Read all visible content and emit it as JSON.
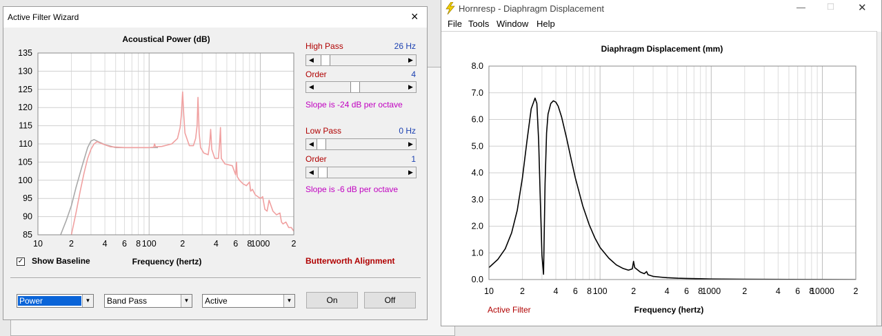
{
  "wizard": {
    "title": "Active Filter Wizard",
    "plot_title": "Acoustical Power (dB)",
    "xlabel": "Frequency (hertz)",
    "show_baseline_label": "Show Baseline",
    "show_baseline_checked": "✓",
    "high_pass": {
      "label": "High Pass",
      "value": "26 Hz",
      "order_label": "Order",
      "order_value": "4",
      "slope": "Slope is -24 dB per octave",
      "position": 0.05,
      "order_position": 0.43
    },
    "low_pass": {
      "label": "Low Pass",
      "value": "0 Hz",
      "order_label": "Order",
      "order_value": "1",
      "slope": "Slope is -6 dB per octave",
      "position": 0.0,
      "order_position": 0.02
    },
    "alignment": "Butterworth Alignment",
    "combo_type": "Power",
    "combo_filter": "Band Pass",
    "combo_mode": "Active",
    "on_button": "On",
    "off_button": "Off",
    "close_icon": "×",
    "colors": {
      "baseline": "#a8a8a8",
      "filtered": "#f0a0a0",
      "label_red": "#b00000",
      "value_blue": "#1a3fb0",
      "slope_magenta": "#c000c0"
    }
  },
  "hornresp": {
    "title": "Hornresp - Diaphragm Displacement",
    "menu": [
      "File",
      "Tools",
      "Window",
      "Help"
    ],
    "plot_title": "Diaphragm Displacement (mm)",
    "xlabel": "Frequency (hertz)",
    "footer_label": "Active Filter",
    "minimize_icon": "—",
    "maximize_icon": "□",
    "close_icon": "✕",
    "app_icon": "lightning-icon"
  },
  "chart_data": [
    {
      "type": "line",
      "title": "Acoustical Power (dB)",
      "xlabel": "Frequency (hertz)",
      "ylabel": "",
      "x_scale": "log",
      "xlim": [
        10,
        2000
      ],
      "ylim": [
        85,
        135
      ],
      "x_tick_labels": [
        "10",
        "2",
        "4",
        "6",
        "8",
        "100",
        "2",
        "4",
        "6",
        "8",
        "1000",
        "2"
      ],
      "y_tick_labels": [
        "85",
        "90",
        "95",
        "100",
        "105",
        "110",
        "115",
        "120",
        "125",
        "130",
        "135"
      ],
      "grid": true,
      "series": [
        {
          "style": "baseline",
          "x": [
            16,
            18,
            20,
            22,
            25,
            28,
            30,
            32,
            35,
            40,
            50,
            60,
            80,
            100,
            120
          ],
          "y": [
            85,
            89,
            93,
            98,
            104,
            109,
            110.8,
            111.2,
            110.6,
            109.8,
            109,
            109,
            109,
            109,
            109
          ]
        },
        {
          "style": "filtered",
          "x": [
            20,
            22,
            24,
            26,
            28,
            30,
            32,
            34,
            38,
            45,
            60,
            80,
            100,
            110,
            112,
            114,
            130,
            160,
            180,
            190,
            195,
            200,
            205,
            210,
            230,
            250,
            262,
            270,
            275,
            282,
            290,
            310,
            340,
            350,
            358,
            366,
            390,
            420,
            430,
            438,
            446,
            480,
            560,
            600,
            610,
            620,
            650,
            700,
            750,
            800,
            820,
            850,
            900,
            950,
            1000,
            1050,
            1100,
            1150,
            1200,
            1300,
            1400,
            1500,
            1550,
            1600,
            1700,
            1800,
            1900,
            2000
          ],
          "y": [
            85,
            91,
            97,
            102,
            106,
            108.5,
            110,
            110.6,
            110,
            109.2,
            109,
            109,
            109,
            109.1,
            110,
            109.2,
            109.3,
            110,
            111.5,
            114.5,
            118,
            124.3,
            118,
            113,
            109.5,
            109.5,
            111.5,
            115,
            122.8,
            113,
            109,
            107.5,
            107,
            110,
            114,
            108.5,
            106,
            106,
            110,
            114.5,
            106,
            104.5,
            104,
            101.5,
            105,
            101,
            100,
            99,
            98.5,
            99.5,
            97,
            97.5,
            96,
            95.5,
            95,
            95.5,
            92,
            91.5,
            94.5,
            91.5,
            90.5,
            91,
            88.5,
            88,
            88.5,
            87,
            87,
            86
          ]
        }
      ]
    },
    {
      "type": "line",
      "title": "Diaphragm Displacement (mm)",
      "xlabel": "Frequency (hertz)",
      "ylabel": "",
      "x_scale": "log",
      "xlim": [
        10,
        20000
      ],
      "ylim": [
        0,
        8
      ],
      "x_tick_labels": [
        "10",
        "2",
        "4",
        "6",
        "8",
        "100",
        "2",
        "4",
        "6",
        "8",
        "1000",
        "2",
        "4",
        "6",
        "8",
        "10000",
        "2"
      ],
      "y_tick_labels": [
        "0.0",
        "1.0",
        "2.0",
        "3.0",
        "4.0",
        "5.0",
        "6.0",
        "7.0",
        "8.0"
      ],
      "grid": true,
      "series": [
        {
          "style": "displacement",
          "x": [
            10,
            12,
            14,
            16,
            18,
            20,
            22,
            24,
            26,
            27,
            28,
            29,
            30,
            31,
            32,
            33,
            34,
            36,
            38,
            40,
            42,
            45,
            50,
            55,
            60,
            70,
            80,
            90,
            100,
            120,
            140,
            160,
            180,
            195,
            200,
            205,
            230,
            250,
            262,
            270,
            300,
            350,
            400,
            500,
            600,
            800,
            1000,
            2000,
            5000,
            20000
          ],
          "y": [
            0.45,
            0.75,
            1.15,
            1.75,
            2.6,
            3.8,
            5.2,
            6.4,
            6.8,
            6.6,
            5.2,
            3.0,
            0.9,
            0.2,
            3.6,
            5.5,
            6.2,
            6.6,
            6.7,
            6.65,
            6.5,
            6.1,
            5.3,
            4.5,
            3.8,
            2.75,
            2.05,
            1.55,
            1.2,
            0.8,
            0.55,
            0.42,
            0.35,
            0.4,
            0.68,
            0.45,
            0.28,
            0.22,
            0.3,
            0.18,
            0.12,
            0.09,
            0.07,
            0.05,
            0.04,
            0.03,
            0.02,
            0.01,
            0.005,
            0.0
          ]
        }
      ]
    }
  ]
}
